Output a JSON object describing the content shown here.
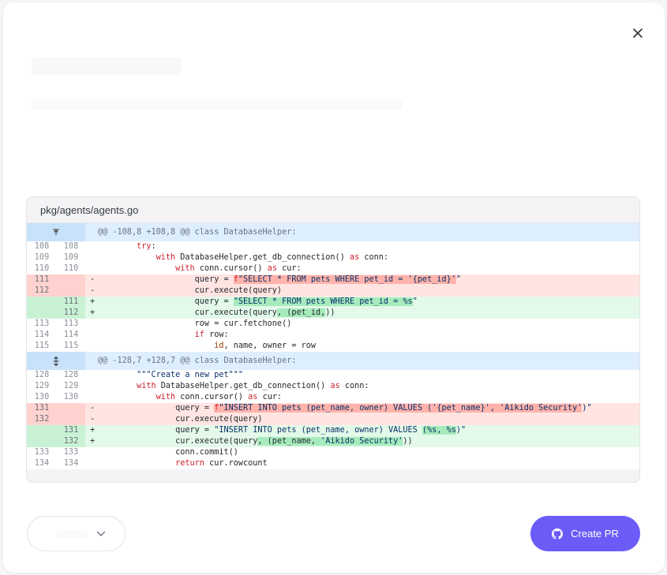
{
  "modal": {
    "close_icon": "close-icon"
  },
  "diff": {
    "file_path": "pkg/agents/agents.go",
    "hunks": [
      {
        "header": "@@ -108,8 +108,8 @@ class DatabaseHelper:",
        "expand_icon": "expand-up-icon"
      },
      {
        "header": "@@ -128,7 +128,7 @@ class DatabaseHelper:",
        "expand_icon": "expand-both-icon"
      }
    ],
    "lines": {
      "l108": {
        "old": "108",
        "new": "108"
      },
      "l109": {
        "old": "109",
        "new": "109"
      },
      "l110": {
        "old": "110",
        "new": "110"
      },
      "l111d": {
        "old": "111",
        "sign": "-"
      },
      "l112d": {
        "old": "112",
        "sign": "-"
      },
      "l111a": {
        "new": "111",
        "sign": "+"
      },
      "l112a": {
        "new": "112",
        "sign": "+"
      },
      "l113": {
        "old": "113",
        "new": "113"
      },
      "l114": {
        "old": "114",
        "new": "114"
      },
      "l115": {
        "old": "115",
        "new": "115"
      },
      "l128": {
        "old": "128",
        "new": "128"
      },
      "l129": {
        "old": "129",
        "new": "129"
      },
      "l130": {
        "old": "130",
        "new": "130"
      },
      "l131d": {
        "old": "131",
        "sign": "-"
      },
      "l132d": {
        "old": "132",
        "sign": "-"
      },
      "l131a": {
        "new": "131",
        "sign": "+"
      },
      "l132a": {
        "new": "132",
        "sign": "+"
      },
      "l133": {
        "old": "133",
        "new": "133"
      },
      "l134": {
        "old": "134",
        "new": "134"
      }
    }
  },
  "footer": {
    "dropdown_icon": "chevron-down-icon",
    "create_pr_label": "Create PR",
    "create_pr_icon": "github-icon",
    "accent_color": "#6c5cf7"
  }
}
